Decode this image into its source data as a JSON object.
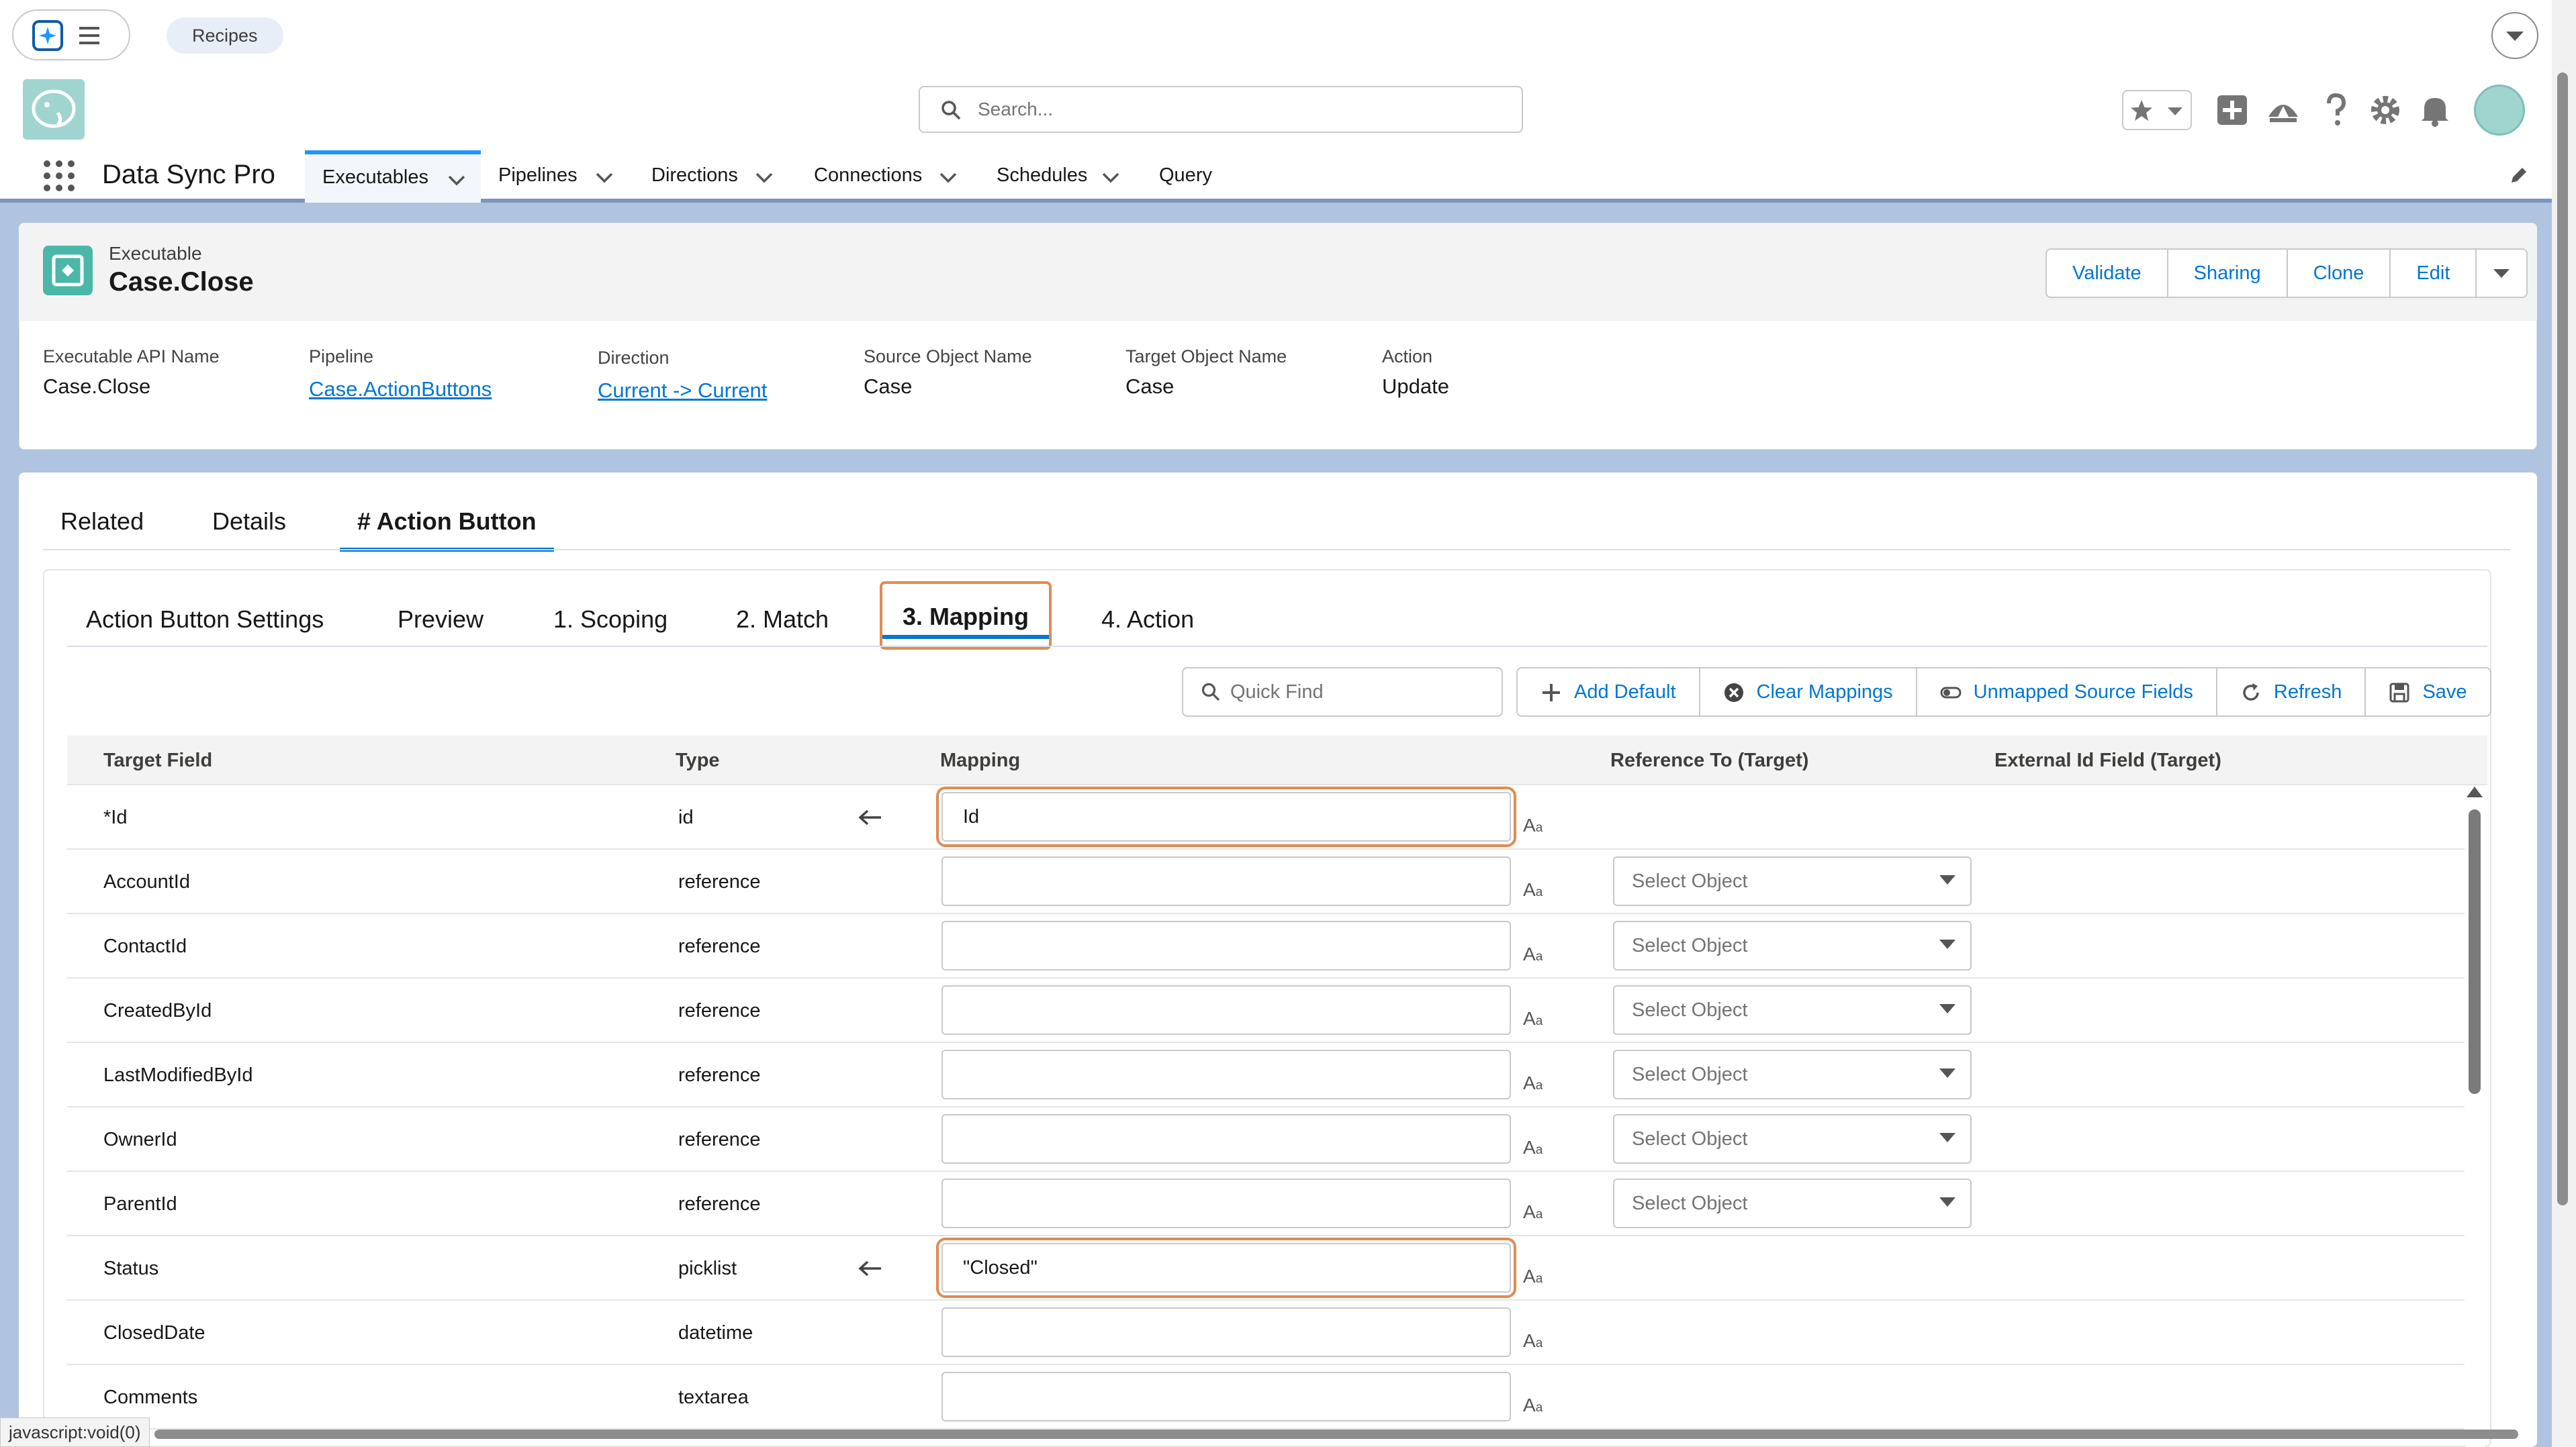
{
  "top_bar": {
    "tab_label": "Recipes"
  },
  "global_header": {
    "search_placeholder": "Search..."
  },
  "nav": {
    "app_name": "Data Sync Pro",
    "items": [
      "Executables",
      "Pipelines",
      "Directions",
      "Connections",
      "Schedules",
      "Query"
    ]
  },
  "record": {
    "type_label": "Executable",
    "title": "Case.Close",
    "actions": [
      "Validate",
      "Sharing",
      "Clone",
      "Edit"
    ],
    "fields": {
      "api_name": {
        "label": "Executable API Name",
        "value": "Case.Close"
      },
      "pipeline": {
        "label": "Pipeline",
        "value": "Case.ActionButtons"
      },
      "direction": {
        "label": "Direction",
        "value": "Current -> Current"
      },
      "source_object": {
        "label": "Source Object Name",
        "value": "Case"
      },
      "target_object": {
        "label": "Target Object Name",
        "value": "Case"
      },
      "action": {
        "label": "Action",
        "value": "Update"
      }
    }
  },
  "tabs": [
    "Related",
    "Details",
    "# Action Button"
  ],
  "subtabs": [
    "Action Button Settings",
    "Preview",
    "1. Scoping",
    "2. Match",
    "3. Mapping",
    "4. Action"
  ],
  "toolbar": {
    "quick_find_placeholder": "Quick Find",
    "buttons": [
      "Add Default",
      "Clear Mappings",
      "Unmapped Source Fields",
      "Refresh",
      "Save"
    ]
  },
  "table": {
    "headers": [
      "Target Field",
      "Type",
      "Mapping",
      "Reference To (Target)",
      "External Id Field (Target)"
    ],
    "select_placeholder": "Select Object",
    "aa_main": "A",
    "aa_sub": "a",
    "rows": [
      {
        "field": "*Id",
        "type": "id",
        "mapping": "Id"
      },
      {
        "field": "AccountId",
        "type": "reference",
        "mapping": ""
      },
      {
        "field": "ContactId",
        "type": "reference",
        "mapping": ""
      },
      {
        "field": "CreatedById",
        "type": "reference",
        "mapping": ""
      },
      {
        "field": "LastModifiedById",
        "type": "reference",
        "mapping": ""
      },
      {
        "field": "OwnerId",
        "type": "reference",
        "mapping": ""
      },
      {
        "field": "ParentId",
        "type": "reference",
        "mapping": ""
      },
      {
        "field": "Status",
        "type": "picklist",
        "mapping": "\"Closed\""
      },
      {
        "field": "ClosedDate",
        "type": "datetime",
        "mapping": ""
      },
      {
        "field": "Comments",
        "type": "textarea",
        "mapping": ""
      }
    ]
  },
  "status_bar": {
    "link_hint": "javascript:void(0)"
  },
  "colors": {
    "brand": "#0176d3",
    "highlight": "#e08b52",
    "nav_band": "#b0c4df"
  }
}
